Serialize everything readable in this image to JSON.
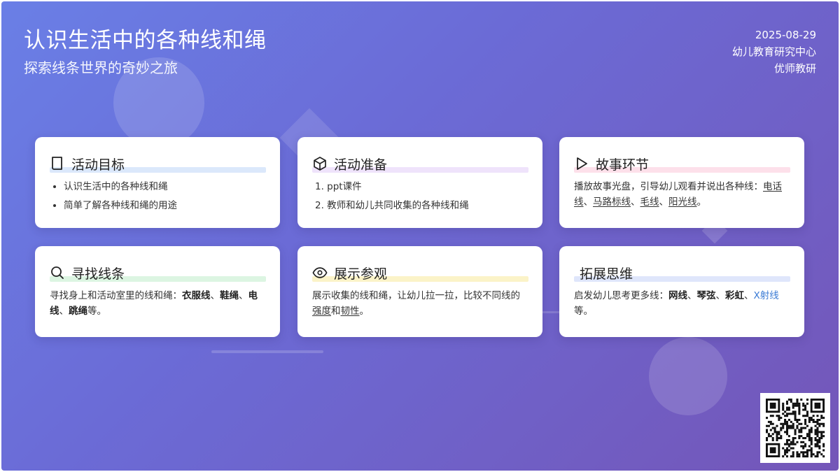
{
  "header": {
    "title": "认识生活中的各种线和绳",
    "subtitle": "探索线条世界的奇妙之旅",
    "date": "2025-08-29",
    "org": "幼儿教育研究中心",
    "author": "优师教研"
  },
  "cards": [
    {
      "title": "活动目标",
      "icon": "book-icon",
      "highlight": "#dbe8fb",
      "items": [
        "认识生活中的各种线和绳",
        "简单了解各种线和绳的用途"
      ]
    },
    {
      "title": "活动准备",
      "icon": "cube-icon",
      "highlight": "#efe3fb",
      "items": [
        "1. ppt课件",
        "2. 教师和幼儿共同收集的各种线和绳"
      ]
    },
    {
      "title": "故事环节",
      "icon": "play-icon",
      "highlight": "#fde0ea",
      "text": "播放故事光盘，引导幼儿观看并说出各种线：",
      "terms": [
        "电话线",
        "马路标线",
        "毛线",
        "阳光线"
      ],
      "sep": "、",
      "end": "。"
    },
    {
      "title": "寻找线条",
      "icon": "search-icon",
      "highlight": "#dcf5e2",
      "text": "寻找身上和活动室里的线和绳：",
      "terms": [
        "衣服线",
        "鞋绳",
        "电线",
        "跳绳"
      ],
      "sep": "、",
      "end": "等。"
    },
    {
      "title": "展示参观",
      "icon": "eye-icon",
      "highlight": "#fbf3c8",
      "text_a": "展示收集的线和绳，让幼儿拉一拉，比较不同线的",
      "term_a": "强度",
      "joiner": "和",
      "term_b": "韧性",
      "end": "。"
    },
    {
      "title": "拓展思维",
      "icon": "",
      "highlight": "#dfe6fb",
      "text": "启发幼儿思考更多线：",
      "terms": [
        "网线",
        "琴弦",
        "彩虹"
      ],
      "sep": "、",
      "link_term": "X射线",
      "end": "等。"
    }
  ],
  "colors": {
    "gradient_start": "#6a7fe6",
    "gradient_end": "#7456b8",
    "link": "#3a7bd5"
  },
  "qr": {
    "icon": "qr-code-icon"
  }
}
